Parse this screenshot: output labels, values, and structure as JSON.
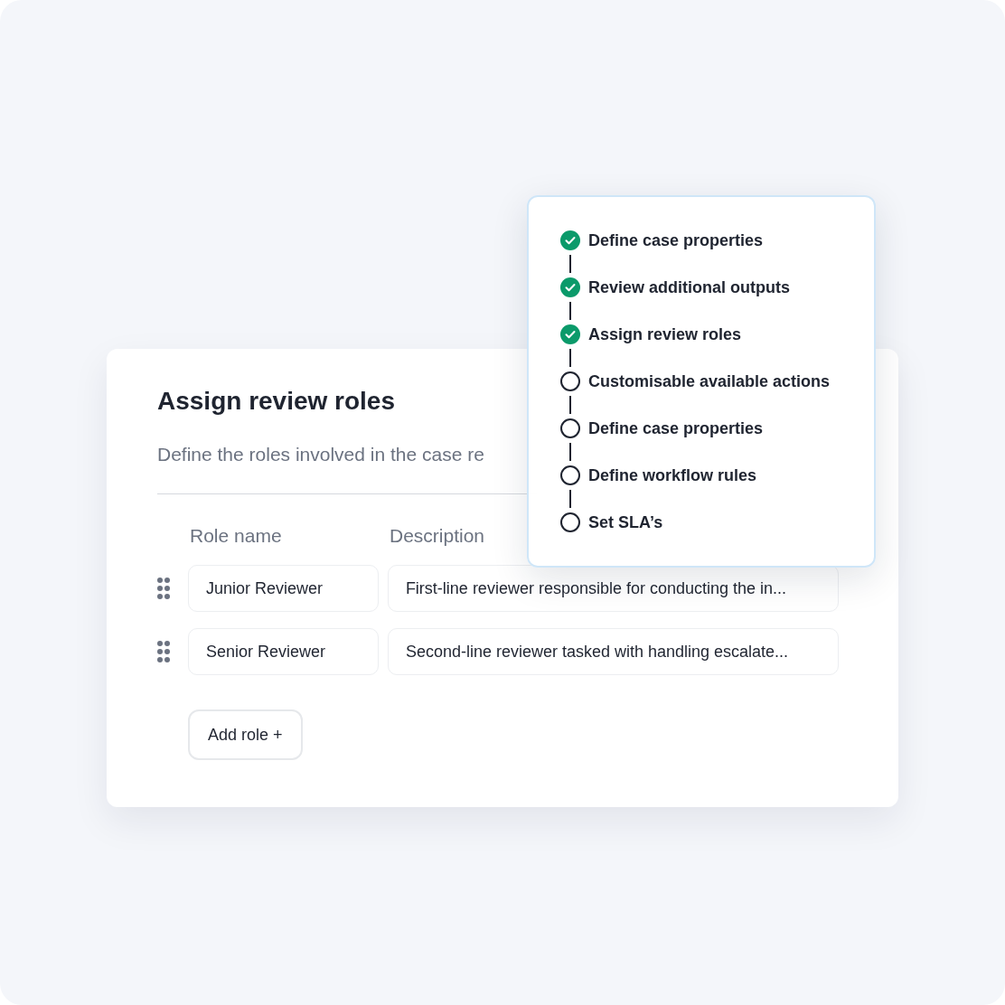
{
  "card": {
    "title": "Assign review roles",
    "subtitle": "Define the roles involved in the case re",
    "columns": [
      "Role name",
      "Description"
    ],
    "rows": [
      {
        "role_name": "Junior Reviewer",
        "description": "First-line reviewer responsible for conducting the in..."
      },
      {
        "role_name": "Senior Reviewer",
        "description": "Second-line reviewer tasked with handling escalate..."
      }
    ],
    "add_button": "Add role +"
  },
  "steps": [
    {
      "label": "Define case properties",
      "done": true
    },
    {
      "label": "Review additional outputs",
      "done": true
    },
    {
      "label": "Assign review roles",
      "done": true
    },
    {
      "label": "Customisable available actions",
      "done": false
    },
    {
      "label": "Define case properties",
      "done": false
    },
    {
      "label": "Define workflow rules",
      "done": false
    },
    {
      "label": "Set SLA’s",
      "done": false
    }
  ]
}
